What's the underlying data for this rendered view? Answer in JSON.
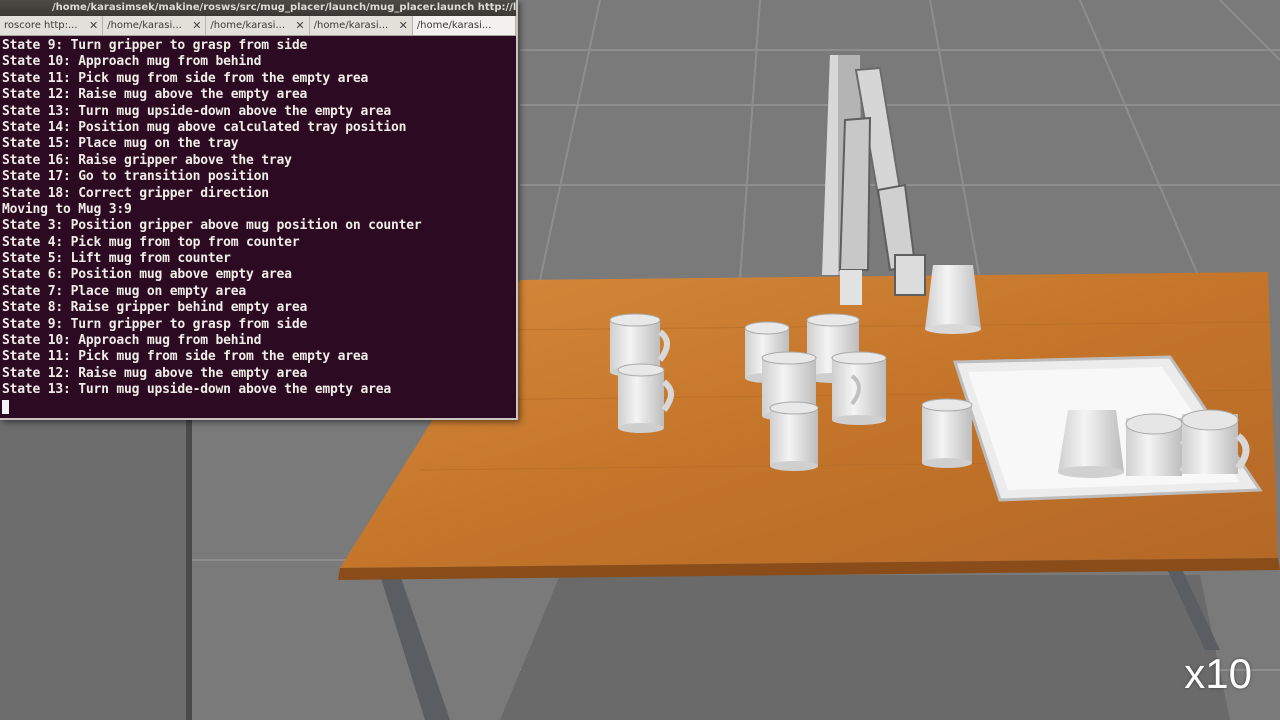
{
  "window": {
    "title": "/home/karasimsek/makine/rosws/src/mug_placer/launch/mug_placer.launch http://localhost:11311"
  },
  "tabs": [
    {
      "label": "roscore http:...",
      "active": false
    },
    {
      "label": "/home/karasi...",
      "active": false
    },
    {
      "label": "/home/karasi...",
      "active": false
    },
    {
      "label": "/home/karasi...",
      "active": false
    },
    {
      "label": "/home/karasi...",
      "active": true
    }
  ],
  "console_lines": [
    "State 9: Turn gripper to grasp from side",
    "State 10: Approach mug from behind",
    "State 11: Pick mug from side from the empty area",
    "State 12: Raise mug above the empty area",
    "State 13: Turn mug upside-down above the empty area",
    "State 14: Position mug above calculated tray position",
    "State 15: Place mug on the tray",
    "State 16: Raise gripper above the tray",
    "State 17: Go to transition position",
    "State 18: Correct gripper direction",
    "Moving to Mug 3:9",
    "State 3: Position gripper above mug position on counter",
    "State 4: Pick mug from top from counter",
    "State 5: Lift mug from counter",
    "State 6: Position mug above empty area",
    "State 7: Place mug on empty area",
    "State 8: Raise gripper behind empty area",
    "State 9: Turn gripper to grasp from side",
    "State 10: Approach mug from behind",
    "State 11: Pick mug from side from the empty area",
    "State 12: Raise mug above the empty area",
    "State 13: Turn mug upside-down above the empty area"
  ],
  "speed_label": "x10",
  "colors": {
    "terminal_bg": "#2c0a22",
    "table": "#c8782c",
    "floor": "#7a7a7a"
  }
}
